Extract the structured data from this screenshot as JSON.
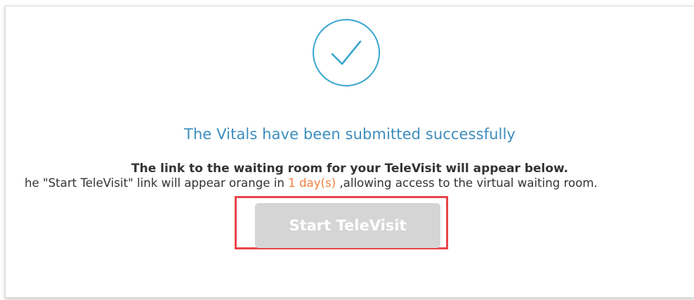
{
  "confirmation": {
    "title": "The Vitals have been submitted successfully",
    "instructions_bold": "The link to the waiting room for your TeleVisit will appear below.",
    "instructions_prefix": "he \"Start TeleVisit\" link will appear orange in ",
    "instructions_days": "1 day(s)",
    "instructions_suffix": " ,allowing access to the virtual waiting room.",
    "start_button_label": "Start TeleVisit",
    "start_button_state": "disabled"
  },
  "icons": {
    "success": "checkmark-circle-icon"
  },
  "colors": {
    "accent": "#3c8dbc",
    "days_highlight": "#f08040",
    "disabled_button": "#d5d5d5",
    "highlight_border": "#e8454a"
  }
}
